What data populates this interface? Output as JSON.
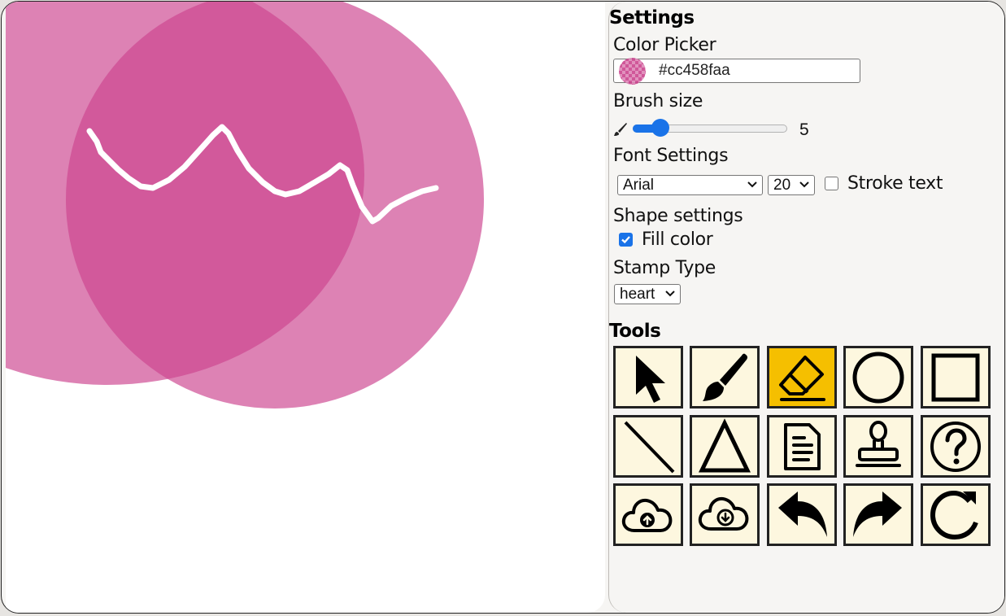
{
  "settings": {
    "title": "Settings",
    "color_picker": {
      "label": "Color Picker",
      "value": "#cc458faa",
      "swatch_color": "#cc458f"
    },
    "brush_size": {
      "label": "Brush size",
      "icon": "paintbrush-icon",
      "value": "5",
      "fraction": 0.1
    },
    "font_settings": {
      "label": "Font Settings",
      "font_family": "Arial",
      "font_size": "20",
      "stroke_text_label": "Stroke text",
      "stroke_text_checked": false
    },
    "shape_settings": {
      "label": "Shape settings",
      "fill_color_label": "Fill color",
      "fill_color_checked": true
    },
    "stamp_type": {
      "label": "Stamp Type",
      "value": "heart"
    }
  },
  "tools": {
    "title": "Tools",
    "items": [
      {
        "name": "select",
        "icon": "cursor-arrow-icon",
        "active": false
      },
      {
        "name": "brush",
        "icon": "paintbrush-icon",
        "active": false
      },
      {
        "name": "eraser",
        "icon": "eraser-icon",
        "active": true
      },
      {
        "name": "circle",
        "icon": "circle-icon",
        "active": false
      },
      {
        "name": "square",
        "icon": "square-icon",
        "active": false
      },
      {
        "name": "line",
        "icon": "line-icon",
        "active": false
      },
      {
        "name": "triangle",
        "icon": "triangle-icon",
        "active": false
      },
      {
        "name": "text",
        "icon": "document-icon",
        "active": false
      },
      {
        "name": "stamp",
        "icon": "stamp-icon",
        "active": false
      },
      {
        "name": "help",
        "icon": "question-icon",
        "active": false
      },
      {
        "name": "upload",
        "icon": "cloud-upload-icon",
        "active": false
      },
      {
        "name": "download",
        "icon": "cloud-download-icon",
        "active": false
      },
      {
        "name": "undo",
        "icon": "undo-arrow-icon",
        "active": false
      },
      {
        "name": "redo",
        "icon": "redo-arrow-icon",
        "active": false
      },
      {
        "name": "clear",
        "icon": "reset-icon",
        "active": false
      }
    ]
  },
  "colors": {
    "circle_fill": "#cc458f",
    "stroke": "#ffffff",
    "active_tool": "#f5bf00",
    "tool_bg": "#fdf7df",
    "accent": "#1a73e8"
  }
}
